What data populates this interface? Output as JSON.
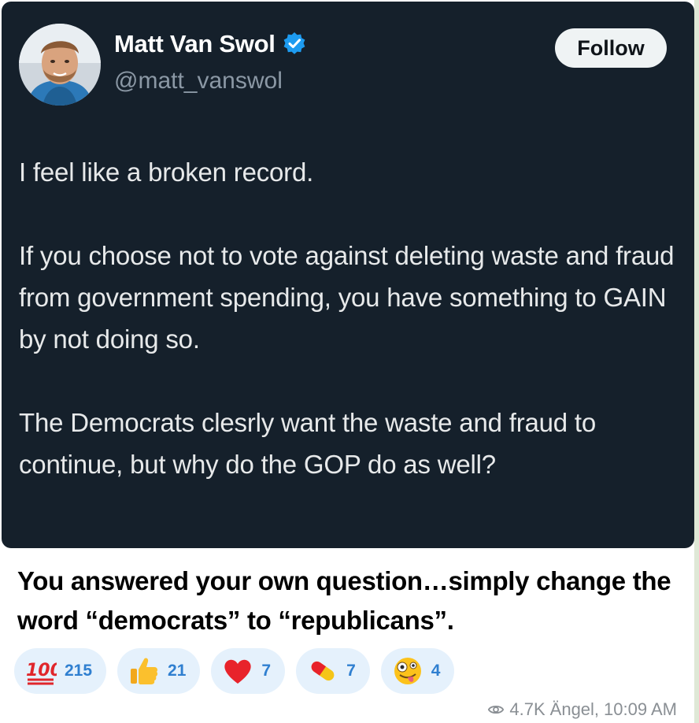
{
  "tweet": {
    "display_name": "Matt Van Swol",
    "handle": "@matt_vanswol",
    "follow_label": "Follow",
    "paragraphs": [
      "I feel like a broken record.",
      "If you choose not to vote against deleting waste and fraud from government spending, you have something to GAIN by not doing so.",
      "The Democrats clesrly want the waste and fraud to continue, but why do the GOP do as well?"
    ],
    "verified_icon": "verified-badge-icon",
    "colors": {
      "card_bg": "#15202b",
      "verified": "#1d9bf0",
      "follow_bg": "#eff3f4"
    }
  },
  "comment": {
    "text": "You answered your own question…simply change the word “democrats” to “republicans”."
  },
  "reactions": [
    {
      "emoji": "hundred-points-icon",
      "count": "215"
    },
    {
      "emoji": "thumbs-up-icon",
      "count": "21"
    },
    {
      "emoji": "red-heart-icon",
      "count": "7"
    },
    {
      "emoji": "pill-icon",
      "count": "7"
    },
    {
      "emoji": "zany-face-icon",
      "count": "4"
    }
  ],
  "footer": {
    "views": "4.7K",
    "author": "Ängel,",
    "time": "10:09 AM",
    "views_icon": "eye-icon",
    "accent": "#2f7fd0"
  }
}
